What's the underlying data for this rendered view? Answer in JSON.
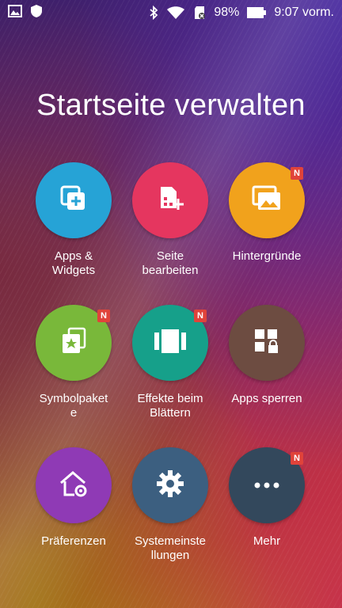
{
  "status_bar": {
    "battery_percent": "98%",
    "time": "9:07 vorm.",
    "icons": [
      "gallery-icon",
      "shield-icon",
      "bluetooth-icon",
      "wifi-icon",
      "sd-card-icon",
      "battery-icon"
    ]
  },
  "title": "Startseite verwalten",
  "tiles": [
    {
      "label": "Apps &\nWidgets",
      "color": "#26a3d6",
      "icon": "apps-widgets-icon",
      "badge": ""
    },
    {
      "label": "Seite\nbearbeiten",
      "color": "#e5365f",
      "icon": "edit-page-icon",
      "badge": ""
    },
    {
      "label": "Hintergründe",
      "color": "#f1a21c",
      "icon": "wallpapers-icon",
      "badge": "N"
    },
    {
      "label": "Symbolpaket\ne",
      "color": "#79b83a",
      "icon": "icon-pack-icon",
      "badge": "N"
    },
    {
      "label": "Effekte beim\nBlättern",
      "color": "#16a08a",
      "icon": "scroll-effects-icon",
      "badge": "N"
    },
    {
      "label": "Apps sperren",
      "color": "#6d4c41",
      "icon": "app-lock-icon",
      "badge": ""
    },
    {
      "label": "Präferenzen",
      "color": "#8f3ab5",
      "icon": "home-settings-icon",
      "badge": ""
    },
    {
      "label": "Systemeinste\nllungen",
      "color": "#3c5f80",
      "icon": "gear-icon",
      "badge": ""
    },
    {
      "label": "Mehr",
      "color": "#33485c",
      "icon": "more-icon",
      "badge": "N"
    }
  ]
}
